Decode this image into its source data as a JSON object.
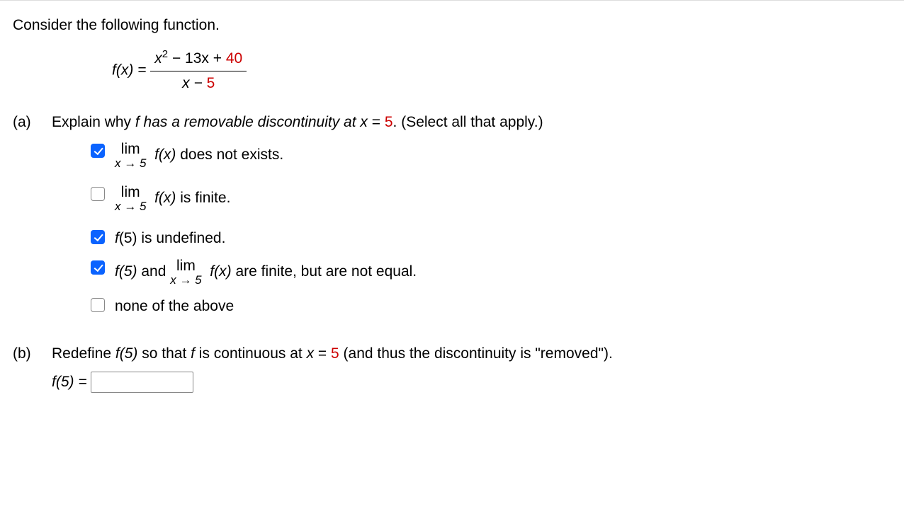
{
  "intro": "Consider the following function.",
  "func": {
    "lhs": "f(x) = ",
    "num_prefix": "x",
    "num_exp": "2",
    "num_rest": " − 13x + ",
    "num_red": "40",
    "den_prefix": "x − ",
    "den_red": "5"
  },
  "partA": {
    "label": "(a)",
    "prompt_before": "Explain why ",
    "prompt_fhas": "f has a removable discontinuity at ",
    "prompt_x": "x",
    "prompt_eq": " = ",
    "prompt_val": "5",
    "prompt_after": ". (Select all that apply.)",
    "options": [
      {
        "checked": true,
        "kind": "lim",
        "lim_top": "lim",
        "lim_bot": "x → 5",
        "fx": "f(x)",
        "tail": " does not exists."
      },
      {
        "checked": false,
        "kind": "lim",
        "lim_top": "lim",
        "lim_bot": "x → 5",
        "fx": "f(x)",
        "tail": " is finite."
      },
      {
        "checked": true,
        "kind": "plain",
        "text_ital": "f",
        "text_rest": "(5) is undefined."
      },
      {
        "checked": true,
        "kind": "f5lim",
        "f5": "f(5)",
        "mid": " and  ",
        "lim_top": "lim",
        "lim_bot": "x → 5",
        "fx": "f(x)",
        "tail": " are finite, but are not equal."
      },
      {
        "checked": false,
        "kind": "plain",
        "text_ital": "",
        "text_rest": "none of the above"
      }
    ]
  },
  "partB": {
    "label": "(b)",
    "prompt_1": "Redefine ",
    "prompt_f5": "f(5)",
    "prompt_2": " so that ",
    "prompt_f": "f",
    "prompt_3": " is continuous at ",
    "prompt_x": "x",
    "prompt_eq": " = ",
    "prompt_val": "5",
    "prompt_4": " (and thus the discontinuity is \"removed\").",
    "answer_lhs": "f(5) = ",
    "answer_value": ""
  }
}
